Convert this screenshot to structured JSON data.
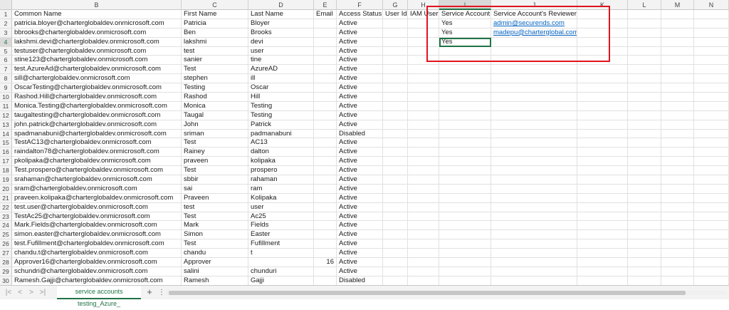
{
  "columns": [
    "B",
    "C",
    "D",
    "E",
    "F",
    "G",
    "H",
    "I",
    "J",
    "K",
    "L",
    "M",
    "N"
  ],
  "active_column": "I",
  "active_row": 4,
  "rows": [
    {
      "n": 1,
      "cells": [
        "Common Name",
        "First Name",
        "Last Name",
        "Email",
        "Access Status",
        "User Id",
        "IAM User",
        "Service Account",
        "Service Account's Reviewer",
        "",
        "",
        "",
        ""
      ]
    },
    {
      "n": 2,
      "cells": [
        "patricia.bloyer@charterglobaldev.onmicrosoft.com",
        "Patricia",
        "Bloyer",
        "",
        "Active",
        "",
        "",
        "Yes",
        "admin@securends.com",
        "",
        "",
        "",
        ""
      ]
    },
    {
      "n": 3,
      "cells": [
        "bbrooks@charterglobaldev.onmicrosoft.com",
        "Ben",
        "Brooks",
        "",
        "Active",
        "",
        "",
        "Yes",
        "madepu@charterglobal.com",
        "",
        "",
        "",
        ""
      ]
    },
    {
      "n": 4,
      "cells": [
        "lakshmi.devi@charterglobaldev.onmicrosoft.com",
        "lakshmi",
        "devi",
        "",
        "Active",
        "",
        "",
        "Yes",
        "",
        "",
        "",
        "",
        ""
      ]
    },
    {
      "n": 5,
      "cells": [
        "testuser@charterglobaldev.onmicrosoft.com",
        "test",
        "user",
        "",
        "Active",
        "",
        "",
        "",
        "",
        "",
        "",
        "",
        ""
      ]
    },
    {
      "n": 6,
      "cells": [
        "stine123@charterglobaldev.onmicrosoft.com",
        "sanier",
        "tine",
        "",
        "Active",
        "",
        "",
        "",
        "",
        "",
        "",
        "",
        ""
      ]
    },
    {
      "n": 7,
      "cells": [
        "test.AzureAd@charterglobaldev.onmicrosoft.com",
        "Test",
        "AzureAD",
        "",
        "Active",
        "",
        "",
        "",
        "",
        "",
        "",
        "",
        ""
      ]
    },
    {
      "n": 8,
      "cells": [
        "sill@charterglobaldev.onmicrosoft.com",
        "stephen",
        "ill",
        "",
        "Active",
        "",
        "",
        "",
        "",
        "",
        "",
        "",
        ""
      ]
    },
    {
      "n": 9,
      "cells": [
        "OscarTesting@charterglobaldev.onmicrosoft.com",
        "Testing",
        "Oscar",
        "",
        "Active",
        "",
        "",
        "",
        "",
        "",
        "",
        "",
        ""
      ]
    },
    {
      "n": 10,
      "cells": [
        "Rashod.Hill@charterglobaldev.onmicrosoft.com",
        "Rashod",
        "Hill",
        "",
        "Active",
        "",
        "",
        "",
        "",
        "",
        "",
        "",
        ""
      ]
    },
    {
      "n": 11,
      "cells": [
        "Monica.Testing@charterglobaldev.onmicrosoft.com",
        "Monica",
        "Testing",
        "",
        "Active",
        "",
        "",
        "",
        "",
        "",
        "",
        "",
        ""
      ]
    },
    {
      "n": 12,
      "cells": [
        "taugaltesting@charterglobaldev.onmicrosoft.com",
        "Taugal",
        "Testing",
        "",
        "Active",
        "",
        "",
        "",
        "",
        "",
        "",
        "",
        ""
      ]
    },
    {
      "n": 13,
      "cells": [
        "john.patrick@charterglobaldev.onmicrosoft.com",
        "John",
        "Patrick",
        "",
        "Active",
        "",
        "",
        "",
        "",
        "",
        "",
        "",
        ""
      ]
    },
    {
      "n": 14,
      "cells": [
        "spadmanabuni@charterglobaldev.onmicrosoft.com",
        "sriman",
        "padmanabuni",
        "",
        "Disabled",
        "",
        "",
        "",
        "",
        "",
        "",
        "",
        ""
      ]
    },
    {
      "n": 15,
      "cells": [
        "TestAC13@charterglobaldev.onmicrosoft.com",
        "Test",
        "AC13",
        "",
        "Active",
        "",
        "",
        "",
        "",
        "",
        "",
        "",
        ""
      ]
    },
    {
      "n": 16,
      "cells": [
        "raindalton78@charterglobaldev.onmicrosoft.com",
        "Rainey",
        "dalton",
        "",
        "Active",
        "",
        "",
        "",
        "",
        "",
        "",
        "",
        ""
      ]
    },
    {
      "n": 17,
      "cells": [
        "pkolipaka@charterglobaldev.onmicrosoft.com",
        "praveen",
        "kolipaka",
        "",
        "Active",
        "",
        "",
        "",
        "",
        "",
        "",
        "",
        ""
      ]
    },
    {
      "n": 18,
      "cells": [
        "Test.prospero@charterglobaldev.onmicrosoft.com",
        "Test",
        "prospero",
        "",
        "Active",
        "",
        "",
        "",
        "",
        "",
        "",
        "",
        ""
      ]
    },
    {
      "n": 19,
      "cells": [
        "srahaman@charterglobaldev.onmicrosoft.com",
        "sbbir",
        "rahaman",
        "",
        "Active",
        "",
        "",
        "",
        "",
        "",
        "",
        "",
        ""
      ]
    },
    {
      "n": 20,
      "cells": [
        "sram@charterglobaldev.onmicrosoft.com",
        "sai",
        "ram",
        "",
        "Active",
        "",
        "",
        "",
        "",
        "",
        "",
        "",
        ""
      ]
    },
    {
      "n": 21,
      "cells": [
        "praveen.kolipaka@charterglobaldev.onmicrosoft.com",
        "Praveen",
        "Kolipaka",
        "",
        "Active",
        "",
        "",
        "",
        "",
        "",
        "",
        "",
        ""
      ]
    },
    {
      "n": 22,
      "cells": [
        "test.user@charterglobaldev.onmicrosoft.com",
        "test",
        "user",
        "",
        "Active",
        "",
        "",
        "",
        "",
        "",
        "",
        "",
        ""
      ]
    },
    {
      "n": 23,
      "cells": [
        "TestAc25@charterglobaldev.onmicrosoft.com",
        "Test",
        "Ac25",
        "",
        "Active",
        "",
        "",
        "",
        "",
        "",
        "",
        "",
        ""
      ]
    },
    {
      "n": 24,
      "cells": [
        "Mark.Fields@charterglobaldev.onmicrosoft.com",
        "Mark",
        "Fields",
        "",
        "Active",
        "",
        "",
        "",
        "",
        "",
        "",
        "",
        ""
      ]
    },
    {
      "n": 25,
      "cells": [
        "simon.easter@charterglobaldev.onmicrosoft.com",
        "Simon",
        "Easter",
        "",
        "Active",
        "",
        "",
        "",
        "",
        "",
        "",
        "",
        ""
      ]
    },
    {
      "n": 26,
      "cells": [
        "test.Fufillment@charterglobaldev.onmicrosoft.com",
        "Test",
        "Fufillment",
        "",
        "Active",
        "",
        "",
        "",
        "",
        "",
        "",
        "",
        ""
      ]
    },
    {
      "n": 27,
      "cells": [
        "chandu.t@charterglobaldev.onmicrosoft.com",
        "chandu",
        "t",
        "",
        "Active",
        "",
        "",
        "",
        "",
        "",
        "",
        "",
        ""
      ]
    },
    {
      "n": 28,
      "cells": [
        "Approver16@charterglobaldev.onmicrosoft.com",
        "Approver",
        "",
        "16",
        "Active",
        "",
        "",
        "",
        "",
        "",
        "",
        "",
        ""
      ]
    },
    {
      "n": 29,
      "cells": [
        "schundri@charterglobaldev.onmicrosoft.com",
        "salini",
        "chunduri",
        "",
        "Active",
        "",
        "",
        "",
        "",
        "",
        "",
        "",
        ""
      ]
    },
    {
      "n": 30,
      "cells": [
        "Ramesh.Gajji@charterglobaldev.onmicrosoft.com",
        "Ramesh",
        "Gajji",
        "",
        "Disabled",
        "",
        "",
        "",
        "",
        "",
        "",
        "",
        ""
      ]
    }
  ],
  "tabbar": {
    "sheet_tab": "service accounts testing_Azure_",
    "add_sheet": "+",
    "more": "⋮",
    "nav_first": "|<",
    "nav_prev": "<",
    "nav_next": ">",
    "nav_last": ">|"
  }
}
